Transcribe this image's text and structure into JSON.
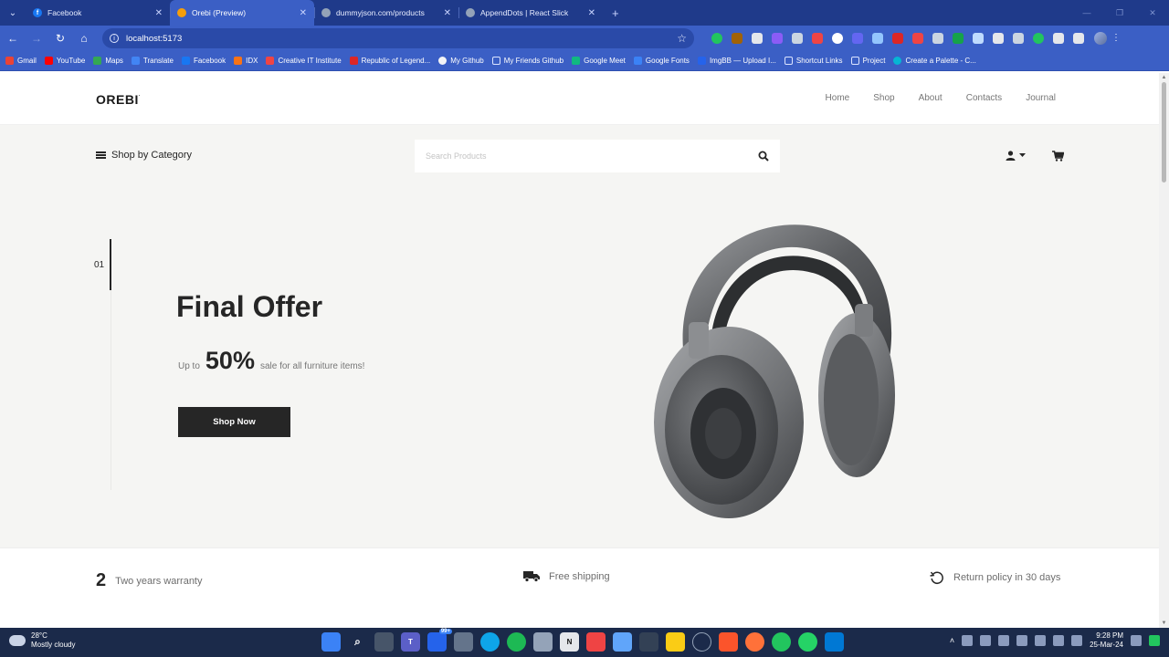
{
  "browser": {
    "tabs": [
      {
        "title": "Facebook",
        "color": "#1877f2",
        "glyph": "f",
        "active": false
      },
      {
        "title": "Orebi (Preview)",
        "color": "#f59e0b",
        "glyph": "",
        "active": true
      },
      {
        "title": "dummyjson.com/products",
        "color": "#94a3b8",
        "glyph": "",
        "active": false
      },
      {
        "title": "AppendDots | React Slick",
        "color": "#94a3b8",
        "glyph": "",
        "active": false
      }
    ],
    "url": "localhost:5173",
    "bookmarks": [
      {
        "label": "Gmail",
        "color": "#ea4335"
      },
      {
        "label": "YouTube",
        "color": "#ff0000"
      },
      {
        "label": "Maps",
        "color": "#34a853"
      },
      {
        "label": "Translate",
        "color": "#4285f4"
      },
      {
        "label": "Facebook",
        "color": "#1877f2"
      },
      {
        "label": "IDX",
        "color": "#f97316"
      },
      {
        "label": "Creative IT Institute",
        "color": "#ef4444"
      },
      {
        "label": "Republic of Legend...",
        "color": "#dc2626"
      },
      {
        "label": "My Github",
        "color": "#111827"
      },
      {
        "label": "My Friends Github",
        "color": "#6b7280"
      },
      {
        "label": "Google Meet",
        "color": "#10b981"
      },
      {
        "label": "Google Fonts",
        "color": "#3b82f6"
      },
      {
        "label": "ImgBB — Upload I...",
        "color": "#2563eb"
      },
      {
        "label": "Shortcut Links",
        "color": "#6b7280"
      },
      {
        "label": "Project",
        "color": "#6b7280"
      },
      {
        "label": "Create a Palette - C...",
        "color": "#06b6d4"
      }
    ]
  },
  "site": {
    "logo": "OREBI",
    "nav": [
      "Home",
      "Shop",
      "About",
      "Contacts",
      "Journal"
    ],
    "category_label": "Shop by Category",
    "search_placeholder": "Search Products",
    "hero": {
      "slide_number": "01",
      "title": "Final Offer",
      "prefix": "Up to",
      "highlight": "50%",
      "suffix": "sale for all furniture items!",
      "button": "Shop Now"
    },
    "benefits": [
      {
        "lead": "2",
        "text": "Two years warranty",
        "icon": "number"
      },
      {
        "lead": "",
        "text": "Free shipping",
        "icon": "truck-icon"
      },
      {
        "lead": "",
        "text": "Return policy in 30 days",
        "icon": "return-icon"
      }
    ]
  },
  "taskbar": {
    "temp": "28°C",
    "condition": "Mostly cloudy",
    "time": "9:28 PM",
    "date": "25-Mar-24",
    "badge": "99+"
  }
}
